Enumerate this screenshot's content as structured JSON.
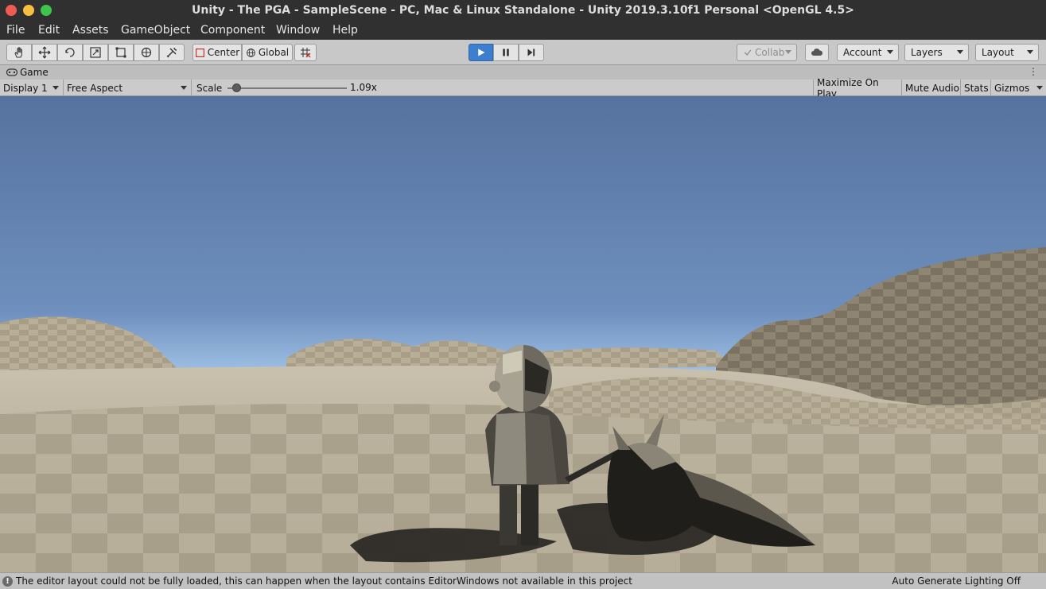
{
  "window": {
    "title": "Unity - The PGA - SampleScene - PC, Mac & Linux Standalone - Unity 2019.3.10f1 Personal <OpenGL 4.5>"
  },
  "menu": {
    "items": [
      "File",
      "Edit",
      "Assets",
      "GameObject",
      "Component",
      "Window",
      "Help"
    ]
  },
  "toolbar": {
    "tools": [
      "hand-tool-icon",
      "move-tool-icon",
      "rotate-tool-icon",
      "scale-tool-icon",
      "rect-tool-icon",
      "transform-tool-icon",
      "custom-tool-icon"
    ],
    "pivot_label": "Center",
    "space_label": "Global",
    "collab_label": "Collab",
    "account_label": "Account",
    "layers_label": "Layers",
    "layout_label": "Layout"
  },
  "game_tab": {
    "label": "Game"
  },
  "game_bar": {
    "display": "Display 1",
    "aspect": "Free Aspect",
    "scale_label": "Scale",
    "scale_value": "1.09x",
    "maximize_label": "Maximize On Play",
    "mute_label": "Mute Audio",
    "stats_label": "Stats",
    "gizmos_label": "Gizmos"
  },
  "status": {
    "message": "The editor layout could not be fully loaded, this can happen when the layout contains EditorWindows not available in this project",
    "lighting": "Auto Generate Lighting Off"
  },
  "colors": {
    "play_active": "#3c7fcf",
    "title_bar": "#303030",
    "sky_top": "#56729f",
    "sky_horizon": "#9ec0e4",
    "ground": "#b9b09c"
  }
}
